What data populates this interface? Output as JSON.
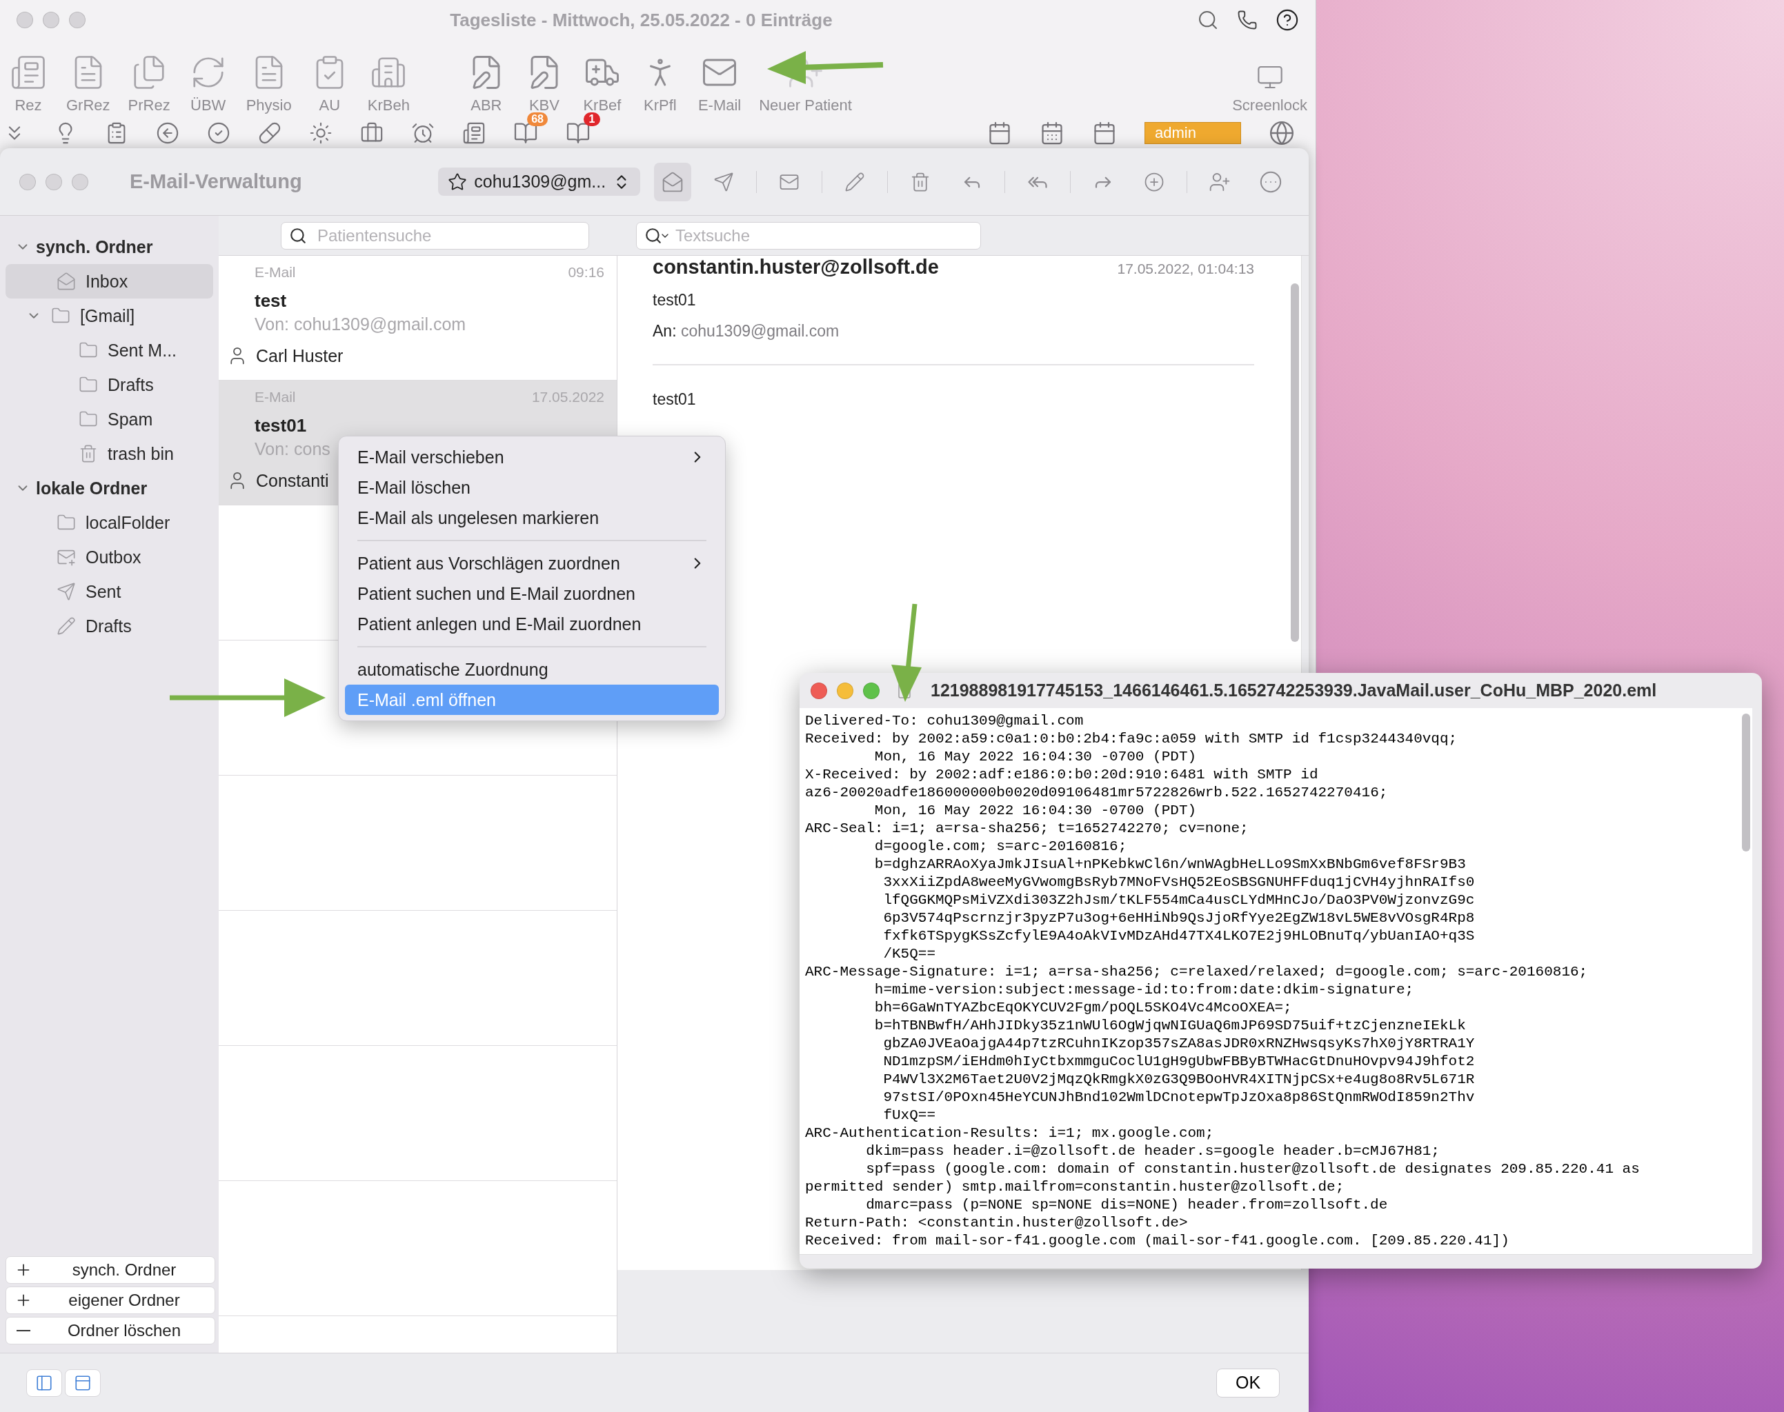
{
  "background_window": {
    "title": "Tagesliste - Mittwoch, 25.05.2022 - 0 Einträge",
    "toolbar_left": [
      {
        "label": "Rez"
      },
      {
        "label": "GrRez"
      },
      {
        "label": "PrRez"
      },
      {
        "label": "ÜBW"
      },
      {
        "label": "Physio"
      },
      {
        "label": "AU"
      },
      {
        "label": "KrBeh"
      }
    ],
    "toolbar_middle": [
      {
        "label": "ABR"
      },
      {
        "label": "KBV"
      },
      {
        "label": "KrBef"
      },
      {
        "label": "KrPfl"
      },
      {
        "label": "E-Mail"
      },
      {
        "label": "Neuer Patient"
      }
    ],
    "toolbar_right": [
      {
        "label": "Screenlock"
      }
    ],
    "badges": [
      {
        "text": "68",
        "color": "#f0883a"
      },
      {
        "text": "1",
        "color": "#e0262b"
      }
    ],
    "user_field": "admin"
  },
  "mail_window": {
    "title": "E-Mail-Verwaltung",
    "account": "cohu1309@gm...",
    "patient_search": {
      "placeholder": "Patientensuche"
    },
    "text_search": {
      "placeholder": "Textsuche"
    },
    "sidebar": {
      "sections": [
        {
          "title": "synch. Ordner",
          "expanded": true,
          "items": [
            {
              "label": "Inbox",
              "kind": "inbox",
              "selected": true
            },
            {
              "label": "[Gmail]",
              "kind": "folder",
              "selected": false,
              "expanded": true,
              "children": [
                {
                  "label": "Sent M...",
                  "kind": "folder",
                  "selected": false
                },
                {
                  "label": "Drafts",
                  "kind": "folder",
                  "selected": false
                },
                {
                  "label": "Spam",
                  "kind": "folder",
                  "selected": false
                },
                {
                  "label": "trash bin",
                  "kind": "trash",
                  "selected": false
                }
              ]
            }
          ]
        },
        {
          "title": "lokale Ordner",
          "expanded": true,
          "items": [
            {
              "label": "localFolder",
              "kind": "folder",
              "selected": false
            },
            {
              "label": "Outbox",
              "kind": "outbox",
              "selected": false
            },
            {
              "label": "Sent",
              "kind": "sent",
              "selected": false
            },
            {
              "label": "Drafts",
              "kind": "drafts",
              "selected": false
            }
          ]
        }
      ],
      "buttons": [
        {
          "kind": "add",
          "label": "synch. Ordner"
        },
        {
          "kind": "add",
          "label": "eigener Ordner"
        },
        {
          "kind": "remove",
          "label": "Ordner löschen"
        }
      ]
    },
    "mails": [
      {
        "type": "E-Mail",
        "time": "09:16",
        "subject": "test",
        "from": "Von: cohu1309@gmail.com",
        "patient": "Carl Huster",
        "selected": false
      },
      {
        "type": "E-Mail",
        "time": "17.05.2022",
        "subject": "test01",
        "from": "Von: cons",
        "patient": "Constanti",
        "selected": true
      }
    ],
    "detail": {
      "sender": "constantin.huster@zollsoft.de",
      "date": "17.05.2022, 01:04:13",
      "subject": "test01",
      "to_label": "An:",
      "to": "cohu1309@gmail.com",
      "body": "test01"
    },
    "ok_button": "OK"
  },
  "context_menu": {
    "groups": [
      [
        {
          "label": "E-Mail verschieben",
          "submenu": true,
          "selected": false
        },
        {
          "label": "E-Mail löschen",
          "submenu": false,
          "selected": false
        },
        {
          "label": "E-Mail als ungelesen markieren",
          "submenu": false,
          "selected": false
        }
      ],
      [
        {
          "label": "Patient aus Vorschlägen zuordnen",
          "submenu": true,
          "selected": false
        },
        {
          "label": "Patient suchen und E-Mail zuordnen",
          "submenu": false,
          "selected": false
        },
        {
          "label": "Patient anlegen und E-Mail zuordnen",
          "submenu": false,
          "selected": false
        }
      ],
      [
        {
          "label": "automatische Zuordnung",
          "submenu": false,
          "selected": false
        },
        {
          "label": "E-Mail .eml öffnen",
          "submenu": false,
          "selected": true
        }
      ]
    ]
  },
  "eml_window": {
    "title": "121988981917745153_1466146461.5.1652742253939.JavaMail.user_CoHu_MBP_2020.eml",
    "lines": [
      {
        "kind": "top",
        "text": "Delivered-To: cohu1309@gmail.com"
      },
      {
        "kind": "top",
        "text": "Received: by 2002:a59:c0a1:0:b0:2b4:fa9c:a059 with SMTP id f1csp3244340vqq;"
      },
      {
        "kind": "indent",
        "text": "Mon, 16 May 2022 16:04:30 -0700 (PDT)"
      },
      {
        "kind": "top",
        "text": "X-Received: by 2002:adf:e186:0:b0:20d:910:6481 with SMTP id"
      },
      {
        "kind": "top",
        "text": "az6-20020adfe186000000b0020d09106481mr5722826wrb.522.1652742270416;"
      },
      {
        "kind": "indent",
        "text": "Mon, 16 May 2022 16:04:30 -0700 (PDT)"
      },
      {
        "kind": "top",
        "text": "ARC-Seal: i=1; a=rsa-sha256; t=1652742270; cv=none;"
      },
      {
        "kind": "indent",
        "text": "d=google.com; s=arc-20160816;"
      },
      {
        "kind": "indent",
        "text": "b=dghzARRAoXyaJmkJIsuAl+nPKebkwCl6n/wnWAgbHeLLo9SmXxBNbGm6vef8FSr9B3"
      },
      {
        "kind": "deep",
        "text": "3xxXiiZpdA8weeMyGVwomgBsRyb7MNoFVsHQ52EoSBSGNUHFFduq1jCVH4yjhnRAIfs0"
      },
      {
        "kind": "deep",
        "text": "lfQGGKMQPsMiVZXdi303Z2hJsm/tKLF554mCa4usCLYdMHnCJo/DaO3PV0WjzonvzG9c"
      },
      {
        "kind": "deep",
        "text": "6p3V574qPscrnzjr3pyzP7u3og+6eHHiNb9QsJjoRfYye2EgZW18vL5WE8vVOsgR4Rp8"
      },
      {
        "kind": "deep",
        "text": "fxfk6TSpygKSsZcfylE9A4oAkVIvMDzAHd47TX4LKO7E2j9HLOBnuTq/ybUanIAO+q3S"
      },
      {
        "kind": "deep",
        "text": "/K5Q=="
      },
      {
        "kind": "top",
        "text": "ARC-Message-Signature: i=1; a=rsa-sha256; c=relaxed/relaxed; d=google.com; s=arc-20160816;"
      },
      {
        "kind": "indent",
        "text": "h=mime-version:subject:message-id:to:from:date:dkim-signature;"
      },
      {
        "kind": "indent",
        "text": "bh=6GaWnTYAZbcEqOKYCUV2Fgm/pOQL5SKO4Vc4McoOXEA=;"
      },
      {
        "kind": "indent",
        "text": "b=hTBNBwfH/AHhJIDky35z1nWUl6OgWjqwNIGUaQ6mJP69SD75uif+tzCjenzneIEkLk"
      },
      {
        "kind": "deep",
        "text": "gbZA0JVEaOajgA44p7tzRCuhnIKzop357sZA8asJDR0xRNZHwsqsyKs7hX0jY8RTRA1Y"
      },
      {
        "kind": "deep",
        "text": "ND1mzpSM/iEHdm0hIyCtbxmmguCoclU1gH9gUbwFBByBTWHacGtDnuHOvpv94J9hfot2"
      },
      {
        "kind": "deep",
        "text": "P4WVl3X2M6Taet2U0V2jMqzQkRmgkX0zG3Q9BOoHVR4XITNjpCSx+e4ug8o8Rv5L671R"
      },
      {
        "kind": "deep",
        "text": "97stSI/0POxn45HeYCUNJhBnd102WmlDCnotepwTpJzOxa8p86StQnmRWOdI859n2Thv"
      },
      {
        "kind": "deep",
        "text": "fUxQ=="
      },
      {
        "kind": "top",
        "text": "ARC-Authentication-Results: i=1; mx.google.com;"
      },
      {
        "kind": "auth",
        "text": "dkim=pass header.i=@zollsoft.de header.s=google header.b=cMJ67H81;"
      },
      {
        "kind": "auth",
        "text": "spf=pass (google.com: domain of constantin.huster@zollsoft.de designates 209.85.220.41 as"
      },
      {
        "kind": "top",
        "text": "permitted sender) smtp.mailfrom=constantin.huster@zollsoft.de;"
      },
      {
        "kind": "auth",
        "text": "dmarc=pass (p=NONE sp=NONE dis=NONE) header.from=zollsoft.de"
      },
      {
        "kind": "top",
        "text": "Return-Path: <constantin.huster@zollsoft.de>"
      },
      {
        "kind": "top",
        "text": "Received: from mail-sor-f41.google.com (mail-sor-f41.google.com. [209.85.220.41])"
      }
    ]
  }
}
